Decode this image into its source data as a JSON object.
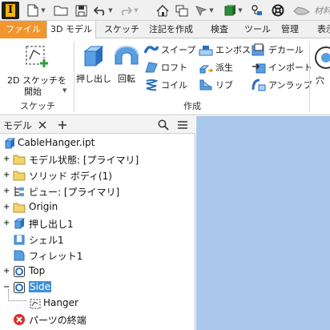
{
  "app": {
    "logo_letter": "I",
    "material_label": "材料"
  },
  "ribbon_tabs": [
    "ファイル",
    "3D モデル",
    "スケッチ",
    "注記を作成",
    "検査",
    "ツール",
    "管理",
    "表示"
  ],
  "sketch_group": {
    "start_sketch_line1": "2D スケッチを",
    "start_sketch_line2": "開始",
    "label": "スケッチ"
  },
  "create_group": {
    "extrude": "押し出し",
    "revolve": "回転",
    "sweep": "スイープ",
    "loft": "ロフト",
    "coil": "コイル",
    "emboss": "エンボス",
    "derive": "派生",
    "rib": "リブ",
    "decal": "デカール",
    "import": "インポート",
    "unwrap": "アンラップ",
    "label": "作成"
  },
  "modify_group": {
    "hole_partial": "穴"
  },
  "browser": {
    "title": "モデル",
    "root": "CableHanger.ipt",
    "items": [
      {
        "label": "モデル状態: [プライマリ]"
      },
      {
        "label": "ソリッド ボディ(1)"
      },
      {
        "label": "ビュー: [プライマリ]"
      },
      {
        "label": "Origin"
      },
      {
        "label": "押し出し1"
      },
      {
        "label": "シェル1"
      },
      {
        "label": "フィレット1"
      },
      {
        "label": "Top"
      },
      {
        "label": "Side"
      },
      {
        "label": "Hanger"
      },
      {
        "label": "パーツの終端"
      }
    ]
  },
  "colors": {
    "file_tab": "#f0962d",
    "selection": "#3d8fd6",
    "viewport": "#a9c8eb",
    "error": "#d9302c"
  }
}
